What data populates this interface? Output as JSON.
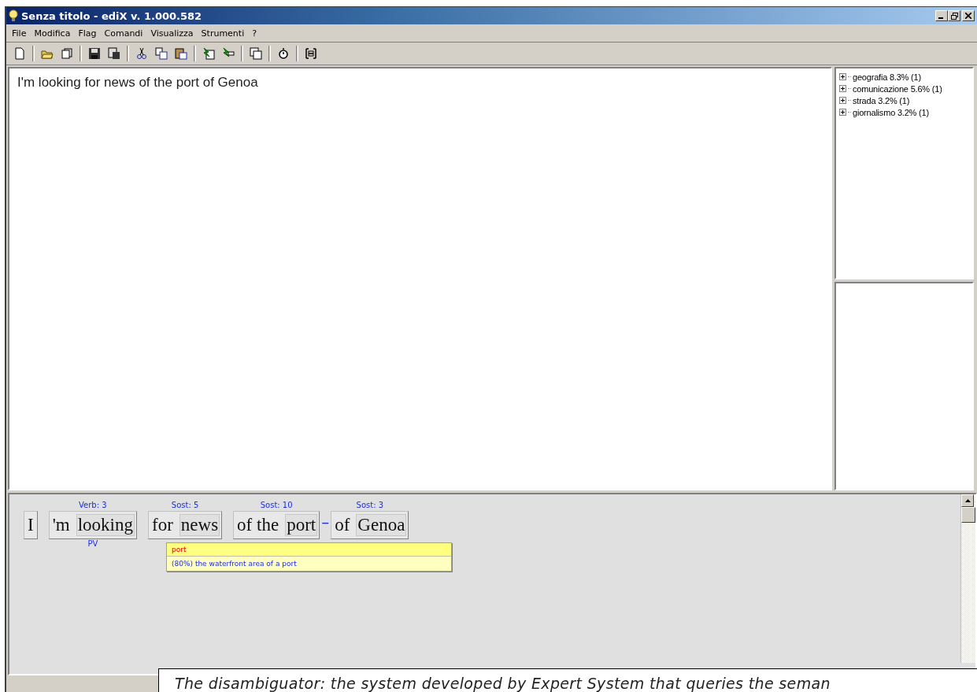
{
  "window": {
    "title": "Senza titolo - ediX v. 1.000.582"
  },
  "menu": [
    "File",
    "Modifica",
    "Flag",
    "Comandi",
    "Visualizza",
    "Strumenti",
    "?"
  ],
  "editor": {
    "text": "I'm looking for news of the port of Genoa"
  },
  "categories": [
    {
      "label": "geografia 8.3% (1)",
      "expanded": false
    },
    {
      "label": "comunicazione 5.6% (1)",
      "expanded": false
    },
    {
      "label": "strada 3.2% (1)",
      "expanded": false
    },
    {
      "label": "giornalismo 3.2% (1)",
      "expanded": false
    }
  ],
  "analysis": {
    "chunks": [
      {
        "words": [
          {
            "text": "I",
            "head": false
          }
        ]
      },
      {
        "above": "Verb: 3",
        "below": "PV",
        "words": [
          {
            "text": "'m",
            "head": false
          },
          {
            "text": "looking",
            "head": true
          }
        ]
      },
      {
        "above": "Sost: 5",
        "words": [
          {
            "text": "for",
            "head": false
          },
          {
            "text": "news",
            "head": true
          }
        ]
      },
      {
        "above": "Sost: 10",
        "words": [
          {
            "text": "of the",
            "head": false
          },
          {
            "text": "port",
            "head": true
          }
        ],
        "link_next": "–"
      },
      {
        "above": "Sost: 3",
        "words": [
          {
            "text": "of",
            "head": false
          },
          {
            "text": "Genoa",
            "head": true
          }
        ]
      }
    ],
    "popup": {
      "title": "port",
      "sense": "(80%) the waterfront area of a port"
    }
  },
  "caption": "The disambiguator: the system developed by Expert System that queries the seman"
}
